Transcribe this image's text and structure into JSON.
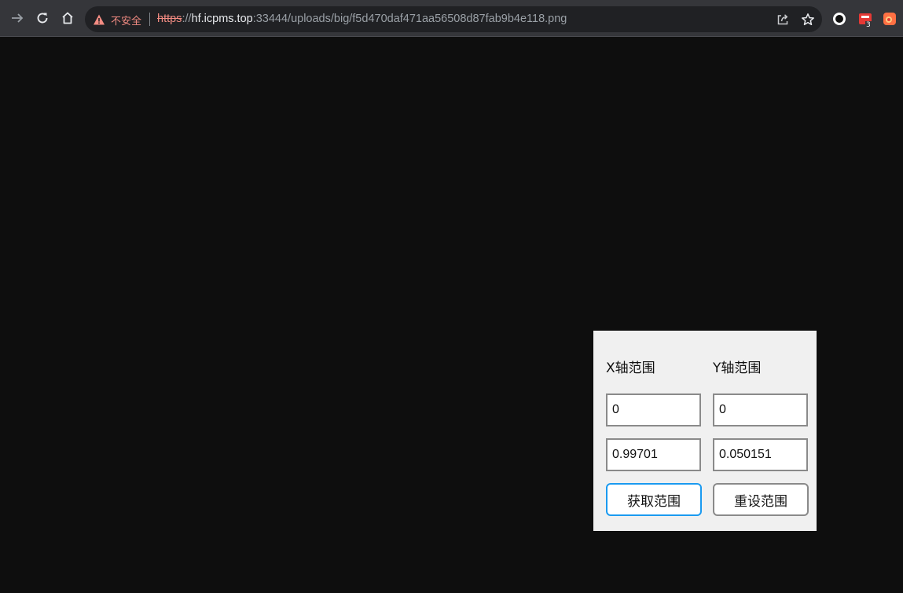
{
  "browser": {
    "security_label": "不安全",
    "url_scheme": "https",
    "url_sep": "://",
    "url_host": "hf.icpms.top",
    "url_rest": ":33444/uploads/big/f5d470daf471aa56508d87fab9b4e118.png",
    "extension_badge": "3",
    "icons": [
      "arrow-right-icon",
      "reload-icon",
      "home-icon",
      "warning-icon",
      "share-icon",
      "star-icon",
      "circle-extension-icon",
      "red-extension-icon",
      "orange-extension-icon"
    ],
    "colors": {
      "insecure": "#f28b82",
      "toolbar": "#35363a",
      "omnibox": "#202124"
    }
  },
  "panel": {
    "x_label": "X轴范围",
    "y_label": "Y轴范围",
    "x_min": "0",
    "y_min": "0",
    "x_max": "0.99701",
    "y_max": "0.050151",
    "get_range_label": "获取范围",
    "reset_range_label": "重设范围",
    "colors": {
      "background": "#f0f0f0",
      "active_border": "#1a9af0"
    }
  }
}
